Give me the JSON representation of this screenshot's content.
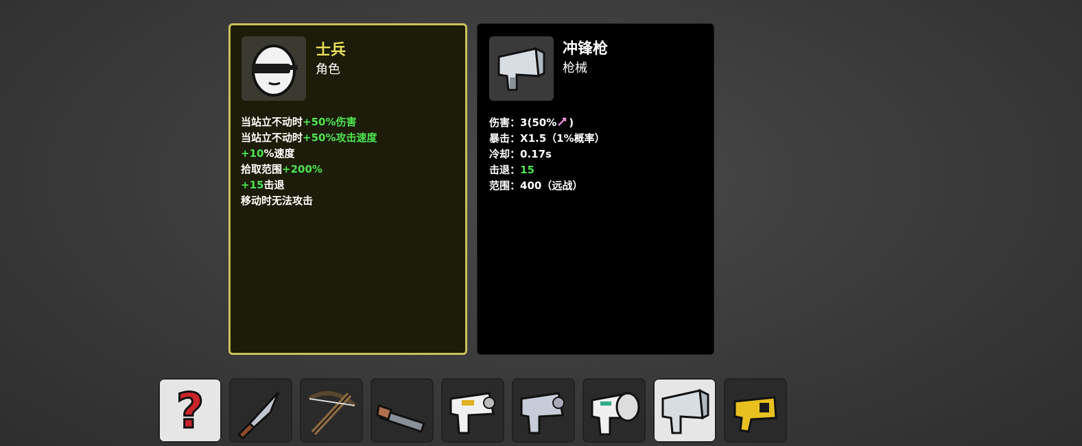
{
  "character_card": {
    "name": "士兵",
    "type": "角色",
    "portrait_icon": "soldier-egg-sunglasses-icon",
    "effects": [
      {
        "prefix": "当站立不动时",
        "value": "+50%伤害",
        "suffix": ""
      },
      {
        "prefix": "当站立不动时",
        "value": "+50%攻击速度",
        "suffix": ""
      },
      {
        "prefix": "",
        "value": "+10",
        "suffix": "%速度"
      },
      {
        "prefix": "拾取范围",
        "value": "+200%",
        "suffix": ""
      },
      {
        "prefix": "",
        "value": "+15",
        "suffix": "击退"
      },
      {
        "prefix": "移动时无法攻击",
        "value": "",
        "suffix": ""
      }
    ]
  },
  "weapon_card": {
    "name": "冲锋枪",
    "type": "枪械",
    "portrait_icon": "smg-icon",
    "stats": [
      {
        "label": "伤害",
        "value": "3(50%",
        "suffix": ")",
        "icon": "ranged-damage-icon"
      },
      {
        "label": "暴击",
        "value": "X1.5（1%概率）"
      },
      {
        "label": "冷却",
        "value": "0.17s"
      },
      {
        "label": "击退",
        "value": "15",
        "green": true
      },
      {
        "label": "范围",
        "value": "400（远战）"
      }
    ]
  },
  "weapon_bar": [
    {
      "icon": "random-question-icon",
      "selected": true
    },
    {
      "icon": "knife-icon",
      "selected": false
    },
    {
      "icon": "crossbow-icon",
      "selected": false
    },
    {
      "icon": "double-barrel-shotgun-icon",
      "selected": false
    },
    {
      "icon": "taser-gun-icon",
      "selected": false
    },
    {
      "icon": "pistol-icon",
      "selected": false
    },
    {
      "icon": "minigun-icon",
      "selected": false
    },
    {
      "icon": "smg-icon",
      "selected": true
    },
    {
      "icon": "yellow-blaster-icon",
      "selected": false
    }
  ],
  "colors": {
    "positive": "#4ee44e",
    "character_name": "#e8df5a",
    "character_border": "#c9c25a"
  }
}
